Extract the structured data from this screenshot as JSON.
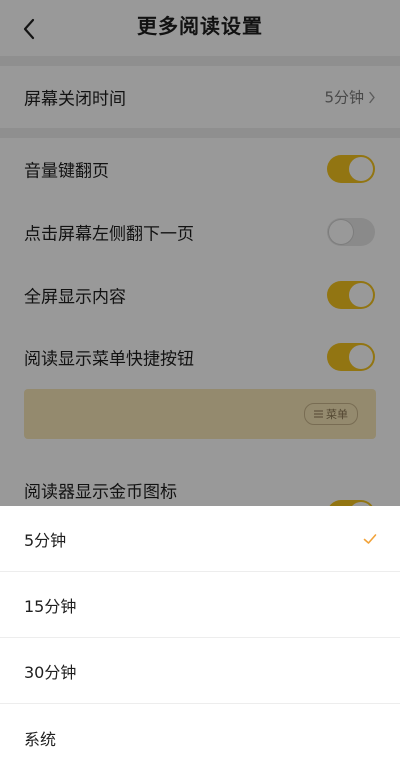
{
  "colors": {
    "accent_yellow": "#f3c31e",
    "check_orange": "#f2a33a",
    "toggle_off": "#e6e6e6",
    "scrim": "rgba(0,0,0,0.40)"
  },
  "header": {
    "title": "更多阅读设置",
    "back_icon": "chevron-left-icon"
  },
  "settings": {
    "screen_off": {
      "label": "屏幕关闭时间",
      "value": "5分钟",
      "chevron_icon": "chevron-right-icon"
    },
    "toggles": [
      {
        "label": "音量键翻页",
        "on": true
      },
      {
        "label": "点击屏幕左侧翻下一页",
        "on": false
      },
      {
        "label": "全屏显示内容",
        "on": true
      },
      {
        "label": "阅读显示菜单快捷按钮",
        "on": true
      },
      {
        "label": "阅读器显示金币图标",
        "on": true
      }
    ],
    "menu_preview": {
      "chip_label": "菜单",
      "chip_icon": "menu-lines-icon"
    }
  },
  "sheet": {
    "options": [
      {
        "label": "5分钟",
        "selected": true
      },
      {
        "label": "15分钟",
        "selected": false
      },
      {
        "label": "30分钟",
        "selected": false
      },
      {
        "label": "系统",
        "selected": false
      }
    ],
    "check_icon": "checkmark-icon"
  }
}
